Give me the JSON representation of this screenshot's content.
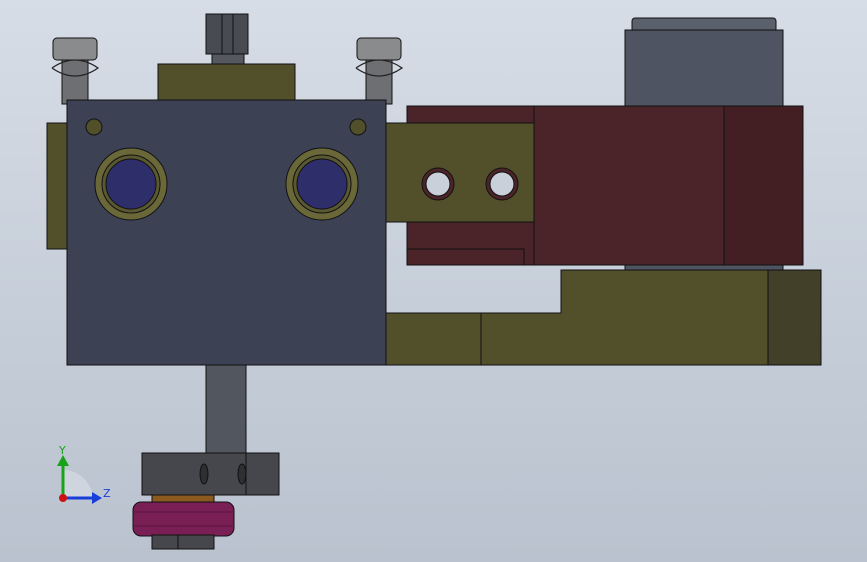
{
  "viewport": {
    "background_top": "#d7dde6",
    "background_bottom": "#b9c2ce"
  },
  "colors": {
    "olive": "#52502b",
    "olive_dark": "#43402a",
    "steel_blue": "#3c4154",
    "maroon": "#4a2428",
    "maroon_dark": "#431f23",
    "cylinder": "#4e5462",
    "rod": "#52565e",
    "bore": "#2d2e6a",
    "collar": "#6a6838",
    "clamp": "#46474d",
    "knob": "#7a1f55",
    "copper": "#8a5a1e",
    "outline": "#111111"
  },
  "triad": {
    "y_label": "Y",
    "z_label": "Z",
    "y_color": "#17a317",
    "z_color": "#1a3fd8",
    "origin_color": "#cc1111"
  }
}
